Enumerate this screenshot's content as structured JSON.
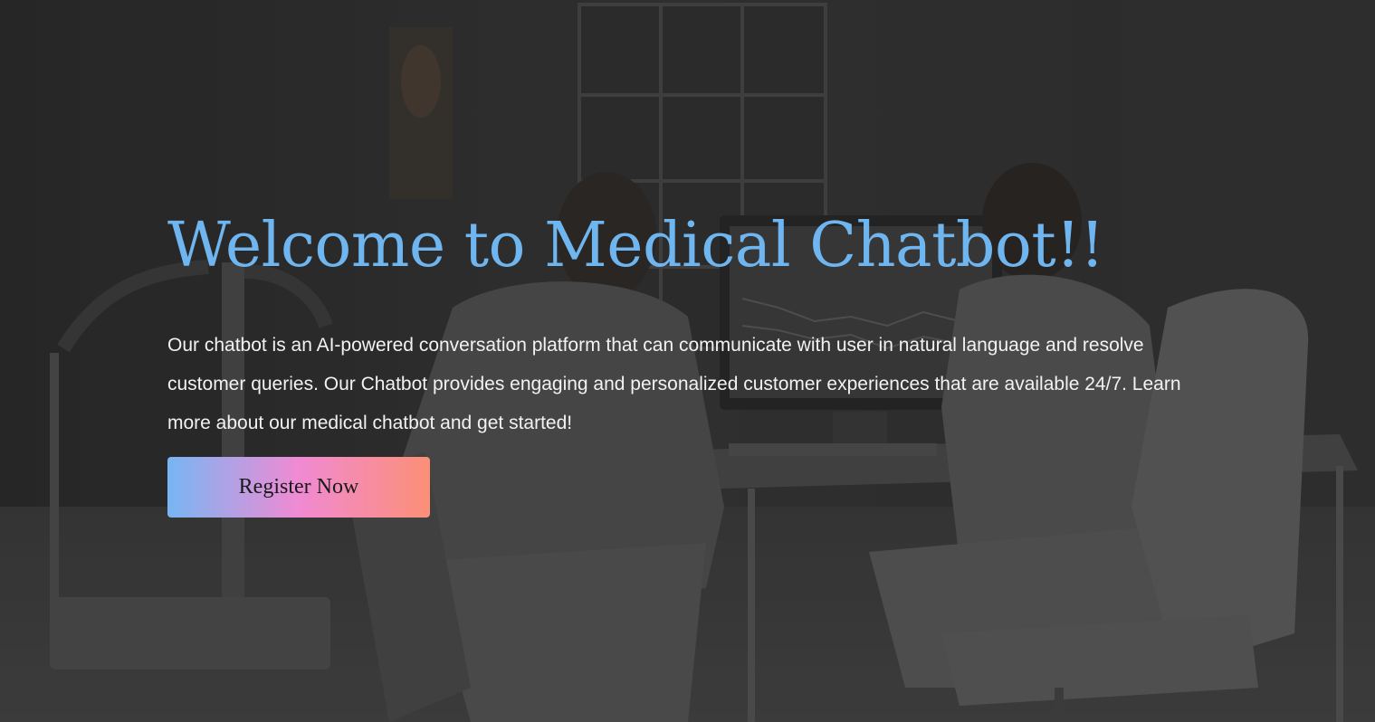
{
  "hero": {
    "title": "Welcome to Medical Chatbot!!",
    "description": "Our chatbot is an AI-powered conversation platform that can communicate with user in natural language and resolve customer queries. Our Chatbot provides engaging and personalized customer experiences that are available 24/7. Learn more about our medical chatbot and get started!",
    "register_label": "Register Now"
  },
  "colors": {
    "title": "#6fb5ef",
    "body_text": "#f2f2f2",
    "button_gradient_start": "#77b6f3",
    "button_gradient_mid": "#f08ad3",
    "button_gradient_end": "#fc8f76"
  },
  "background": {
    "scene": "medical-consultation-photo",
    "tint": "dark"
  }
}
